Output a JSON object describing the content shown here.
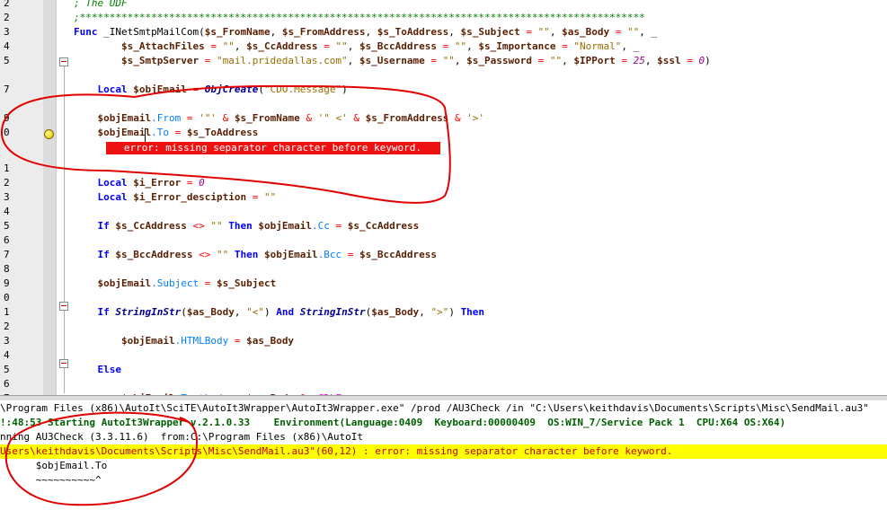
{
  "editor": {
    "lines": [
      {
        "num": "2",
        "html": "<span class='cmt'>; The UDF</span>"
      },
      {
        "num": "2",
        "html": "<span class='cmt'>;***********************************************************************************************</span>"
      },
      {
        "num": "3",
        "html": "<span class='kw'>Func</span> <span class='plain'>_INetSmtpMailCom(</span><span class='var'>$s_FromName</span><span class='plain'>, </span><span class='var'>$s_FromAddress</span><span class='plain'>, </span><span class='var'>$s_ToAddress</span><span class='plain'>, </span><span class='var'>$s_Subject</span> <span class='op'>=</span> <span class='str'>\"\"</span><span class='plain'>, </span><span class='var'>$as_Body</span> <span class='op'>=</span> <span class='str'>\"\"</span><span class='plain'>, _</span>"
      },
      {
        "num": "4",
        "html": "        <span class='var'>$s_AttachFiles</span> <span class='op'>=</span> <span class='str'>\"\"</span><span class='plain'>, </span><span class='var'>$s_CcAddress</span> <span class='op'>=</span> <span class='str'>\"\"</span><span class='plain'>, </span><span class='var'>$s_BccAddress</span> <span class='op'>=</span> <span class='str'>\"\"</span><span class='plain'>, </span><span class='var'>$s_Importance</span> <span class='op'>=</span> <span class='str'>\"Normal\"</span><span class='plain'>, _</span>"
      },
      {
        "num": "5",
        "html": "        <span class='var'>$s_SmtpServer</span> <span class='op'>=</span> <span class='str'>\"mail.pridedallas.com\"</span><span class='plain'>, </span><span class='var'>$s_Username</span> <span class='op'>=</span> <span class='str'>\"\"</span><span class='plain'>, </span><span class='var'>$s_Password</span> <span class='op'>=</span> <span class='str'>\"\"</span><span class='plain'>, </span><span class='var'>$IPPort</span> <span class='op'>=</span> <span class='num'>25</span><span class='plain'>, </span><span class='var'>$ssl</span> <span class='op'>=</span> <span class='num'>0</span><span class='plain'>)</span>"
      },
      {
        "num": "",
        "html": ""
      },
      {
        "num": "7",
        "html": "    <span class='kw'>Local</span> <span class='var'>$objEmail</span> <span class='op'>=</span> <span class='fn'>ObjCreate</span><span class='plain'>(</span><span class='str'>\"CDO.Message\"</span><span class='plain'>)</span>"
      },
      {
        "num": "",
        "html": ""
      },
      {
        "num": "9",
        "html": "    <span class='var'>$objEmail</span><span class='obj'>.From</span> <span class='op'>=</span> <span class='str'>'\"'</span> <span class='op'>&amp;</span> <span class='var'>$s_FromName</span> <span class='op'>&amp;</span> <span class='str'>'\" &lt;'</span> <span class='op'>&amp;</span> <span class='var'>$s_FromAddress</span> <span class='op'>&amp;</span> <span class='str'>'&gt;'</span>"
      },
      {
        "num": "0",
        "html": "    <span class='var'>$objEmail</span><span class='obj'>.To</span> <span class='op'>=</span> <span class='var'>$s_ToAddress</span>"
      },
      {
        "num": "",
        "html": ""
      },
      {
        "num": "1",
        "html": ""
      },
      {
        "num": "2",
        "html": "    <span class='kw'>Local</span> <span class='var'>$i_Error</span> <span class='op'>=</span> <span class='num'>0</span>"
      },
      {
        "num": "3",
        "html": "    <span class='kw'>Local</span> <span class='var'>$i_Error_desciption</span> <span class='op'>=</span> <span class='str'>\"\"</span>"
      },
      {
        "num": "4",
        "html": ""
      },
      {
        "num": "5",
        "html": "    <span class='kw'>If</span> <span class='var'>$s_CcAddress</span> <span class='op'>&lt;&gt;</span> <span class='str'>\"\"</span> <span class='kw'>Then</span> <span class='var'>$objEmail</span><span class='obj'>.Cc</span> <span class='op'>=</span> <span class='var'>$s_CcAddress</span>"
      },
      {
        "num": "6",
        "html": ""
      },
      {
        "num": "7",
        "html": "    <span class='kw'>If</span> <span class='var'>$s_BccAddress</span> <span class='op'>&lt;&gt;</span> <span class='str'>\"\"</span> <span class='kw'>Then</span> <span class='var'>$objEmail</span><span class='obj'>.Bcc</span> <span class='op'>=</span> <span class='var'>$s_BccAddress</span>"
      },
      {
        "num": "8",
        "html": ""
      },
      {
        "num": "9",
        "html": "    <span class='var'>$objEmail</span><span class='obj'>.Subject</span> <span class='op'>=</span> <span class='var'>$s_Subject</span>"
      },
      {
        "num": "0",
        "html": ""
      },
      {
        "num": "1",
        "html": "    <span class='kw'>If</span> <span class='fn'>StringInStr</span><span class='plain'>(</span><span class='var'>$as_Body</span><span class='plain'>, </span><span class='str'>\"&lt;\"</span><span class='plain'>)</span> <span class='kw'>And</span> <span class='fn'>StringInStr</span><span class='plain'>(</span><span class='var'>$as_Body</span><span class='plain'>, </span><span class='str'>\"&gt;\"</span><span class='plain'>)</span> <span class='kw'>Then</span>"
      },
      {
        "num": "2",
        "html": ""
      },
      {
        "num": "3",
        "html": "        <span class='var'>$objEmail</span><span class='obj'>.HTMLBody</span> <span class='op'>=</span> <span class='var'>$as_Body</span>"
      },
      {
        "num": "4",
        "html": ""
      },
      {
        "num": "5",
        "html": "    <span class='kw'>Else</span>"
      },
      {
        "num": "6",
        "html": ""
      },
      {
        "num": "7",
        "html": "        <span class='var'>$objEmail</span><span class='obj'>.Textbody</span> <span class='op'>=</span> <span class='var'>$as_Body</span> <span class='op'>&amp;</span> <span class='mac'>@CRLF</span>"
      }
    ],
    "error_message": "   error: missing separator character before keyword."
  },
  "output": {
    "lines": [
      {
        "cls": "o-cmd",
        "text": "\\Program Files (x86)\\AutoIt\\SciTE\\AutoIt3Wrapper\\AutoIt3Wrapper.exe\" /prod /AU3Check /in \"C:\\Users\\keithdavis\\Documents\\Scripts\\Misc\\SendMail.au3\""
      },
      {
        "cls": "o-green",
        "text": "!:48:53 Starting AutoIt3Wrapper v.2.1.0.33    Environment(Language:0409  Keyboard:00000409  OS:WIN_7/Service Pack 1  CPU:X64 OS:X64)"
      },
      {
        "cls": "o-cmd",
        "text": "nning AU3Check (3.3.11.6)  from:C:\\Program Files (x86)\\AutoIt"
      },
      {
        "cls": "o-red o-hi",
        "text": "Users\\keithdavis\\Documents\\Scripts\\Misc\\SendMail.au3\"(60,12) : error: missing separator character before keyword."
      },
      {
        "cls": "o-cmd",
        "text": "      $objEmail.To"
      },
      {
        "cls": "o-cmd",
        "text": "      ~~~~~~~~~~^"
      }
    ]
  }
}
